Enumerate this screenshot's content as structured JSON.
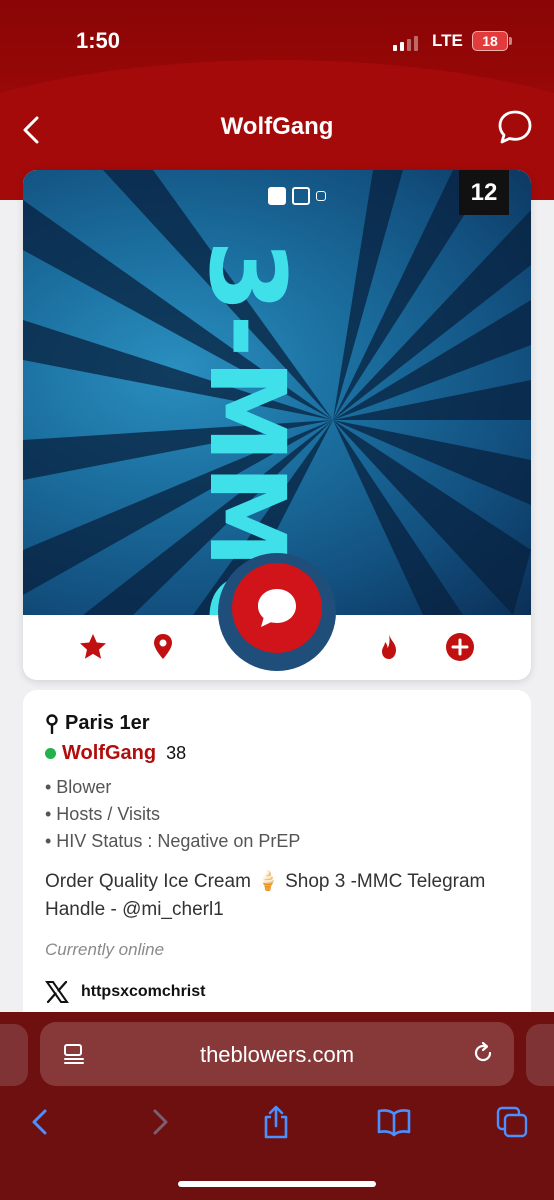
{
  "status_bar": {
    "time": "1:50",
    "network": "LTE",
    "battery": "18"
  },
  "nav": {
    "title": "WolfGang",
    "back_icon": "chevron-left-icon",
    "chat_icon": "chat-bubble-icon"
  },
  "photo": {
    "overlay_text": "3-MMC",
    "photo_count": "12",
    "carousel_pages": 3,
    "carousel_active_index": 0
  },
  "actions": {
    "favorite_icon": "star-icon",
    "location_icon": "map-pin-icon",
    "message_icon": "message-bubble-icon",
    "hot_icon": "flame-icon",
    "add_icon": "plus-circle-icon"
  },
  "profile": {
    "location": "Paris 1er",
    "name": "WolfGang",
    "age": "38",
    "traits": [
      "• Blower",
      "• Hosts / Visits",
      "• HIV Status : Negative on PrEP"
    ],
    "bio": "Order Quality Ice Cream 🍦 Shop 3 -MMC Telegram Handle - @mi_cherl1",
    "online_status": "Currently online",
    "social_handle": "httpsxcomchrist"
  },
  "browser": {
    "url": "theblowers.com",
    "toolbar": [
      "back-icon",
      "forward-icon",
      "share-icon",
      "bookmarks-icon",
      "tabs-icon"
    ]
  },
  "colors": {
    "brand_red": "#b10d0d",
    "header_red": "#a40a0a",
    "browser_bg": "#6e0f10",
    "online_green": "#22b14c",
    "photo_text": "#3fe0ea"
  }
}
